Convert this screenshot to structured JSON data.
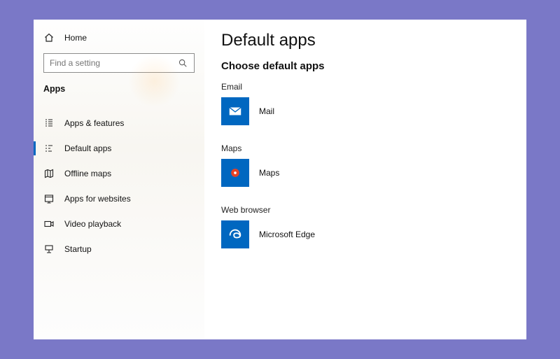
{
  "sidebar": {
    "home": "Home",
    "search_placeholder": "Find a setting",
    "section": "Apps",
    "items": [
      {
        "label": "Apps & features"
      },
      {
        "label": "Default apps"
      },
      {
        "label": "Offline maps"
      },
      {
        "label": "Apps for websites"
      },
      {
        "label": "Video playback"
      },
      {
        "label": "Startup"
      }
    ]
  },
  "main": {
    "title": "Default apps",
    "subheading": "Choose default apps",
    "sections": [
      {
        "category": "Email",
        "app": "Mail"
      },
      {
        "category": "Maps",
        "app": "Maps"
      },
      {
        "category": "Web browser",
        "app": "Microsoft Edge"
      }
    ]
  }
}
